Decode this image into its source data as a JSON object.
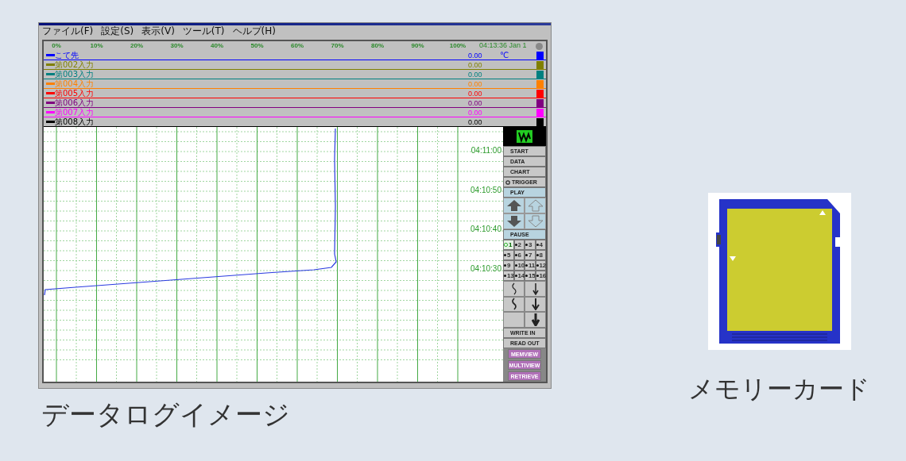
{
  "window": {
    "menu": [
      "ファイル(F)",
      "設定(S)",
      "表示(V)",
      "ツール(T)",
      "ヘルプ(H)"
    ]
  },
  "scale": {
    "ticks": [
      "0%",
      "10%",
      "20%",
      "30%",
      "40%",
      "50%",
      "60%",
      "70%",
      "80%",
      "90%",
      "100%"
    ],
    "time": "04:13:36 Jan 1"
  },
  "channels": [
    {
      "name": "こて先",
      "value": "0.00",
      "unit": "℃",
      "color": "#0000ff"
    },
    {
      "name": "第002入力",
      "value": "0.00",
      "color": "#808000"
    },
    {
      "name": "第003入力",
      "value": "0.00",
      "color": "#008080"
    },
    {
      "name": "第004入力",
      "value": "0.00",
      "color": "#ff8000"
    },
    {
      "name": "第005入力",
      "value": "0.00",
      "color": "#ff0000"
    },
    {
      "name": "第006入力",
      "value": "0.00",
      "color": "#800080"
    },
    {
      "name": "第007入力",
      "value": "0.00",
      "color": "#ff00ff"
    },
    {
      "name": "第008入力",
      "value": "0.00",
      "color": "#000000"
    }
  ],
  "chart": {
    "time_labels": [
      "04:11:00",
      "04:10:50",
      "04:10:40",
      "04:10:30"
    ]
  },
  "panel": {
    "top_buttons": [
      {
        "label": "START",
        "kind": "plain"
      },
      {
        "label": "DATA",
        "kind": "plain"
      },
      {
        "label": "CHART",
        "kind": "plain"
      },
      {
        "label": "TRIGGER",
        "kind": "bullet"
      },
      {
        "label": "PLAY",
        "kind": "blue"
      }
    ],
    "pause": "PAUSE",
    "channel_buttons": [
      {
        "label": "1",
        "selected": true
      },
      {
        "label": "2",
        "selected": false
      },
      {
        "label": "3",
        "selected": false
      },
      {
        "label": "4",
        "selected": false
      },
      {
        "label": "5",
        "selected": false
      },
      {
        "label": "6",
        "selected": false
      },
      {
        "label": "7",
        "selected": false
      },
      {
        "label": "8",
        "selected": false
      },
      {
        "label": "9",
        "selected": false
      },
      {
        "label": "10",
        "selected": false
      },
      {
        "label": "11",
        "selected": false
      },
      {
        "label": "12",
        "selected": false
      },
      {
        "label": "13",
        "selected": false
      },
      {
        "label": "14",
        "selected": false
      },
      {
        "label": "15",
        "selected": false
      },
      {
        "label": "16",
        "selected": false
      }
    ],
    "io_buttons": [
      "WRITE IN",
      "READ OUT"
    ],
    "view_buttons": [
      "MEMVIEW",
      "MULTIVIEW",
      "RETRIEVE"
    ]
  },
  "captions": {
    "log": "データログイメージ",
    "card": "メモリーカード"
  }
}
